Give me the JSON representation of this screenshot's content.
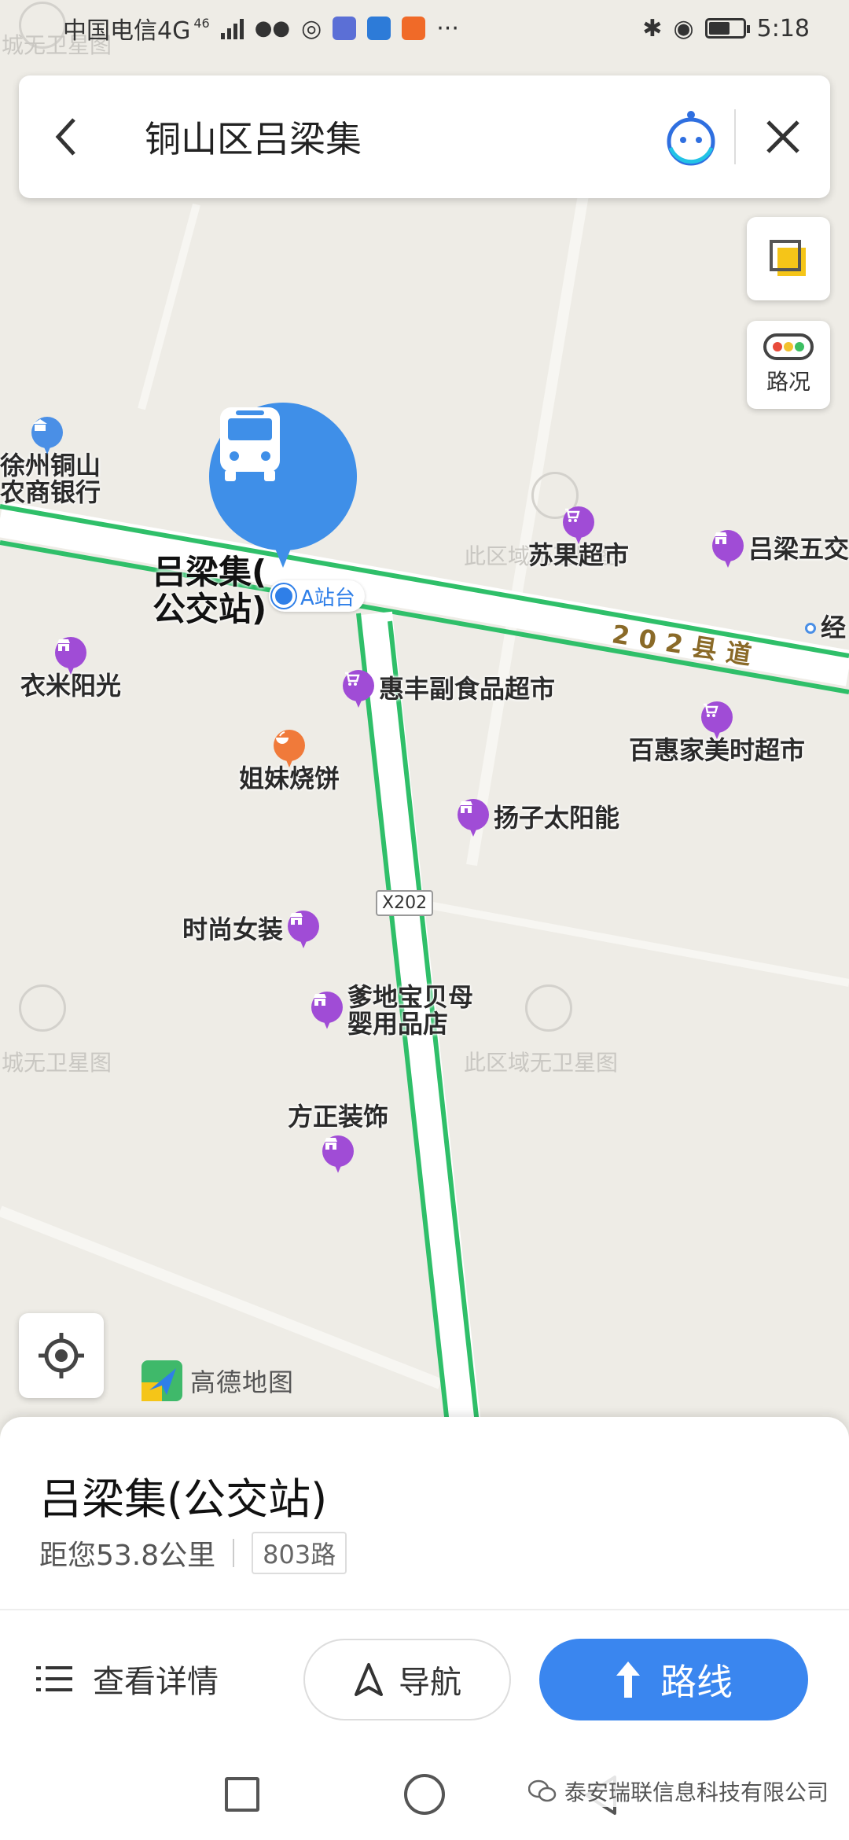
{
  "status_bar": {
    "carrier": "中国电信4G",
    "network_tag": "46",
    "time": "5:18",
    "battery_fill": 0.62
  },
  "search": {
    "query": "铜山区吕梁集"
  },
  "map_controls": {
    "traffic_label": "路况"
  },
  "map": {
    "watermarks": [
      "城无卫星图",
      "此区域无卫星图",
      "城无卫星图",
      "此区域无卫星图"
    ],
    "road_name": "202县道",
    "road_tag": "X202",
    "logo_text": "高德地图",
    "selected_stop": {
      "name_line1": "吕梁集(",
      "name_line2": "公交站)",
      "station_label": "A站台"
    },
    "pois": [
      {
        "label": "徐州铜山\n农商银行",
        "icon": "bank-icon"
      },
      {
        "label": "苏果超市",
        "icon": "shopping-cart-icon"
      },
      {
        "label": "吕梁五交",
        "icon": "shop-icon"
      },
      {
        "label": "经",
        "icon": "dot-icon"
      },
      {
        "label": "衣米阳光",
        "icon": "shop-icon"
      },
      {
        "label": "惠丰副食品超市",
        "icon": "shopping-cart-icon"
      },
      {
        "label": "百惠家美时超市",
        "icon": "shopping-cart-icon"
      },
      {
        "label": "姐妹烧饼",
        "icon": "food-icon"
      },
      {
        "label": "扬子太阳能",
        "icon": "shop-icon"
      },
      {
        "label": "时尚女装",
        "icon": "shop-icon"
      },
      {
        "label": "爹地宝贝母\n婴用品店",
        "icon": "shop-icon"
      },
      {
        "label": "方正装饰",
        "icon": "shop-icon"
      }
    ]
  },
  "sheet": {
    "title": "吕梁集(公交站)",
    "distance": "距您53.8公里",
    "route": "803路",
    "actions": {
      "details": "查看详情",
      "navigate": "导航",
      "route": "路线"
    }
  },
  "watermark_footer": "泰安瑞联信息科技有限公司"
}
